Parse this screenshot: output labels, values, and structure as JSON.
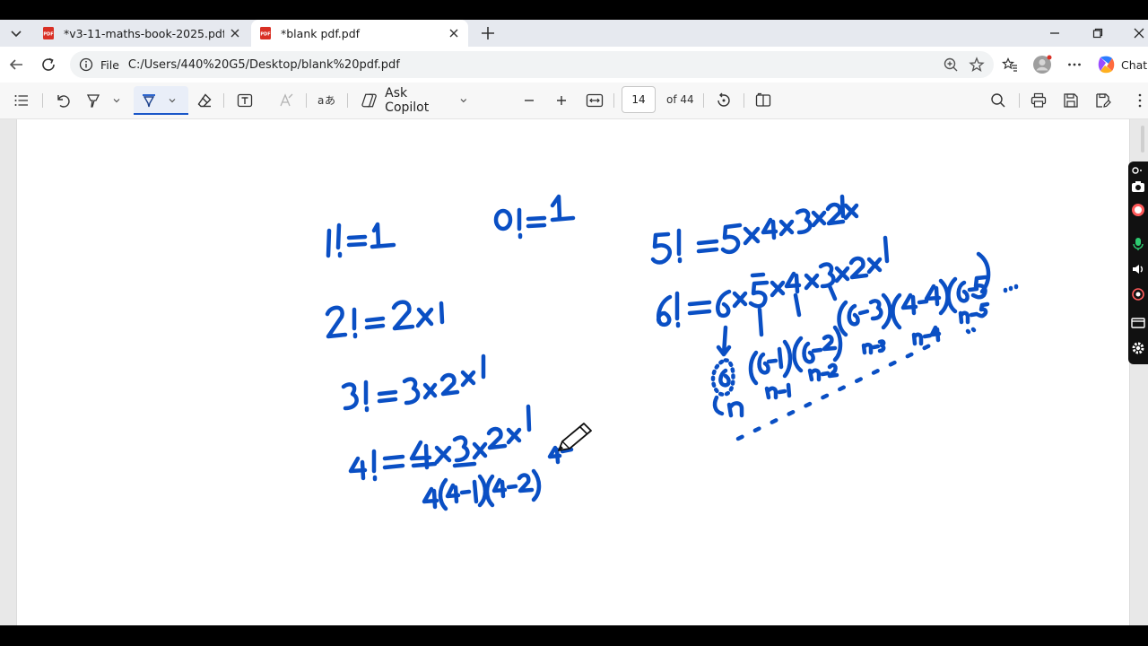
{
  "tabs": [
    {
      "title": "*v3-11-maths-book-2025.pdf",
      "active": false
    },
    {
      "title": "*blank pdf.pdf",
      "active": true
    }
  ],
  "address": {
    "scheme_label": "File",
    "url": "C:/Users/440%20G5/Desktop/blank%20pdf.pdf"
  },
  "copilot": {
    "chat_label": "Chat"
  },
  "pdf_toolbar": {
    "ask_copilot": "Ask Copilot",
    "current_page": "14",
    "page_count": "of 44"
  },
  "ink": {
    "color": "#0a4fc4",
    "pen_icon": "pencil-icon"
  },
  "colors": {
    "accent": "#1a57c9",
    "pdf_badge": "#d93025",
    "toolbar_bg": "#f7f7f7",
    "tabstrip_bg": "#e6e9ef"
  }
}
